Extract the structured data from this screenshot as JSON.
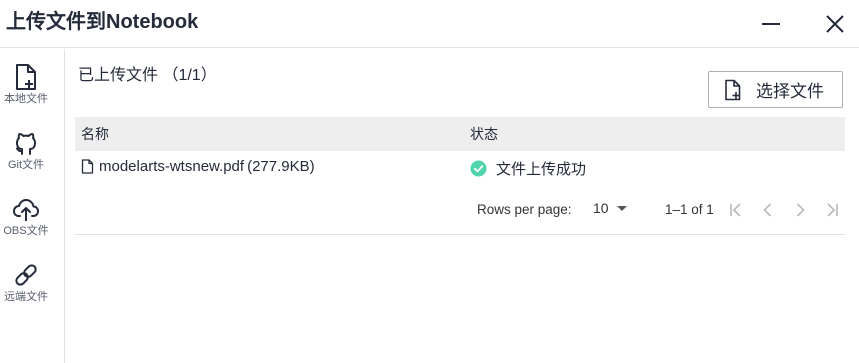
{
  "window": {
    "title": "上传文件到Notebook",
    "minimize_icon": "minimize-icon",
    "close_icon": "close-icon"
  },
  "sidebar": {
    "items": [
      {
        "label": "本地文件",
        "icon": "file-add-icon"
      },
      {
        "label": "Git文件",
        "icon": "github-icon"
      },
      {
        "label": "OBS文件",
        "icon": "cloud-upload-icon"
      },
      {
        "label": "远端文件",
        "icon": "link-icon"
      }
    ]
  },
  "main": {
    "uploaded_title": "已上传文件 （1/1）",
    "choose_button": {
      "label": "选择文件",
      "icon": "file-add-icon"
    },
    "table": {
      "columns": [
        "名称",
        "状态"
      ],
      "rows": [
        {
          "name": "modelarts-wtsnew.pdf",
          "size": "(277.9KB)",
          "status": "文件上传成功",
          "status_color": "#50d4ab"
        }
      ]
    },
    "pagination": {
      "rows_per_page_label": "Rows per page:",
      "rows_per_page_value": "10",
      "range": "1–1 of 1"
    }
  }
}
